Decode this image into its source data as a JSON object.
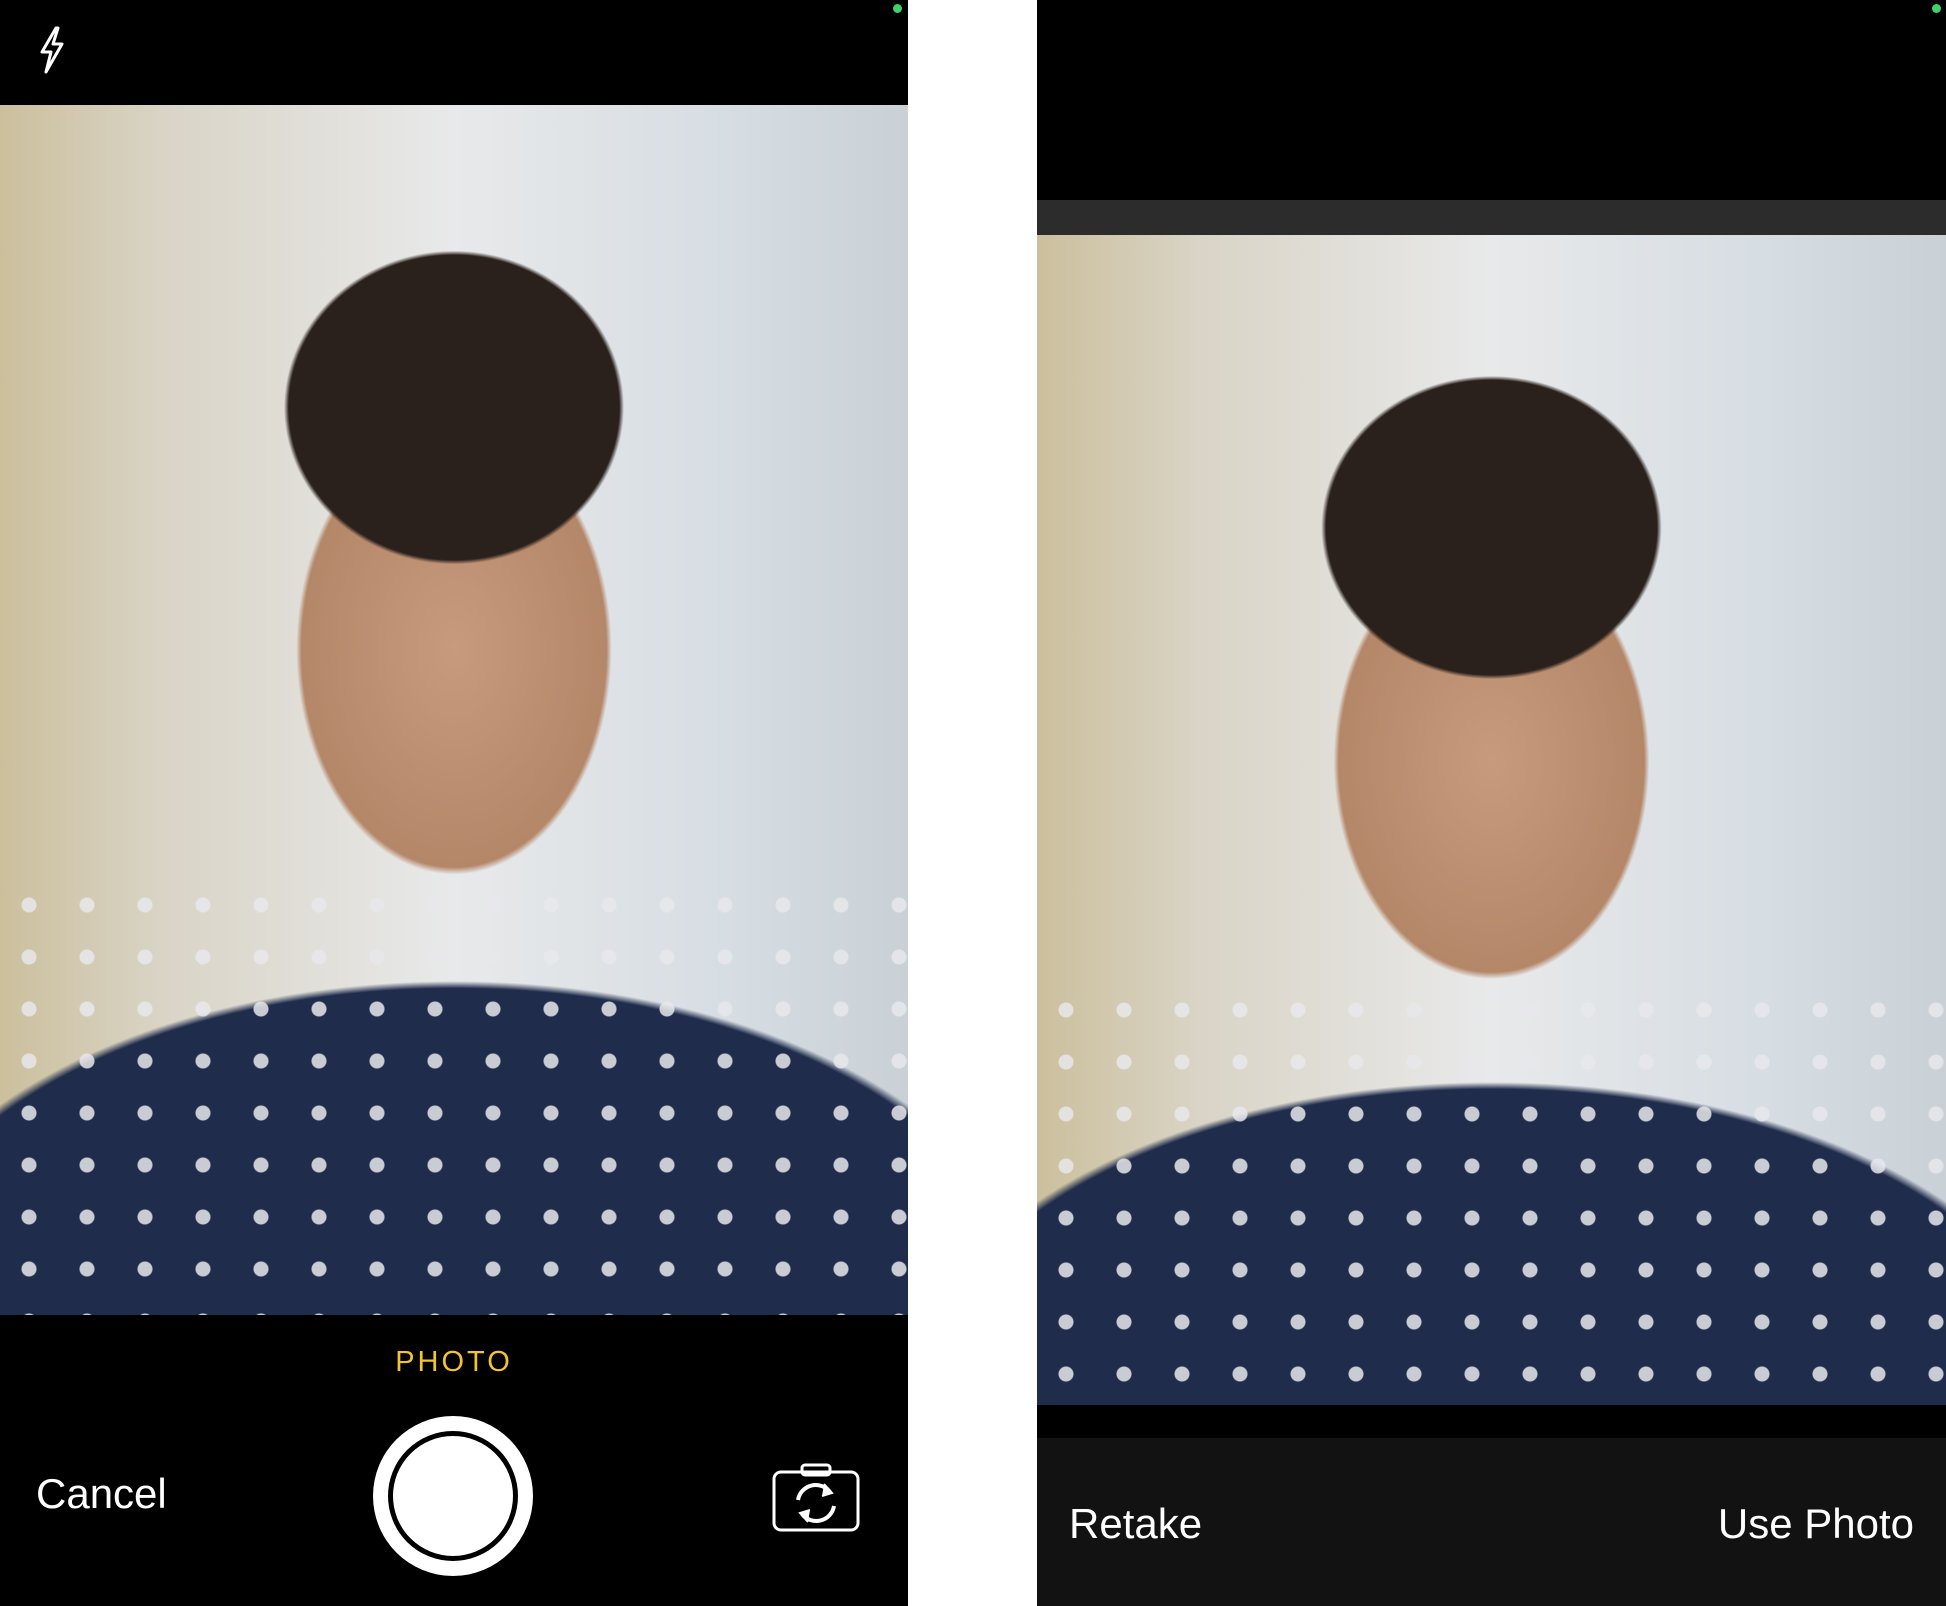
{
  "camera_screen": {
    "mode_label": "PHOTO",
    "cancel_label": "Cancel",
    "flash_icon": "bolt-icon",
    "switch_camera_icon": "camera-rotate-icon",
    "mode_color": "#f4c430"
  },
  "preview_screen": {
    "retake_label": "Retake",
    "use_photo_label": "Use Photo"
  },
  "status_indicator_color": "#3fd16a"
}
